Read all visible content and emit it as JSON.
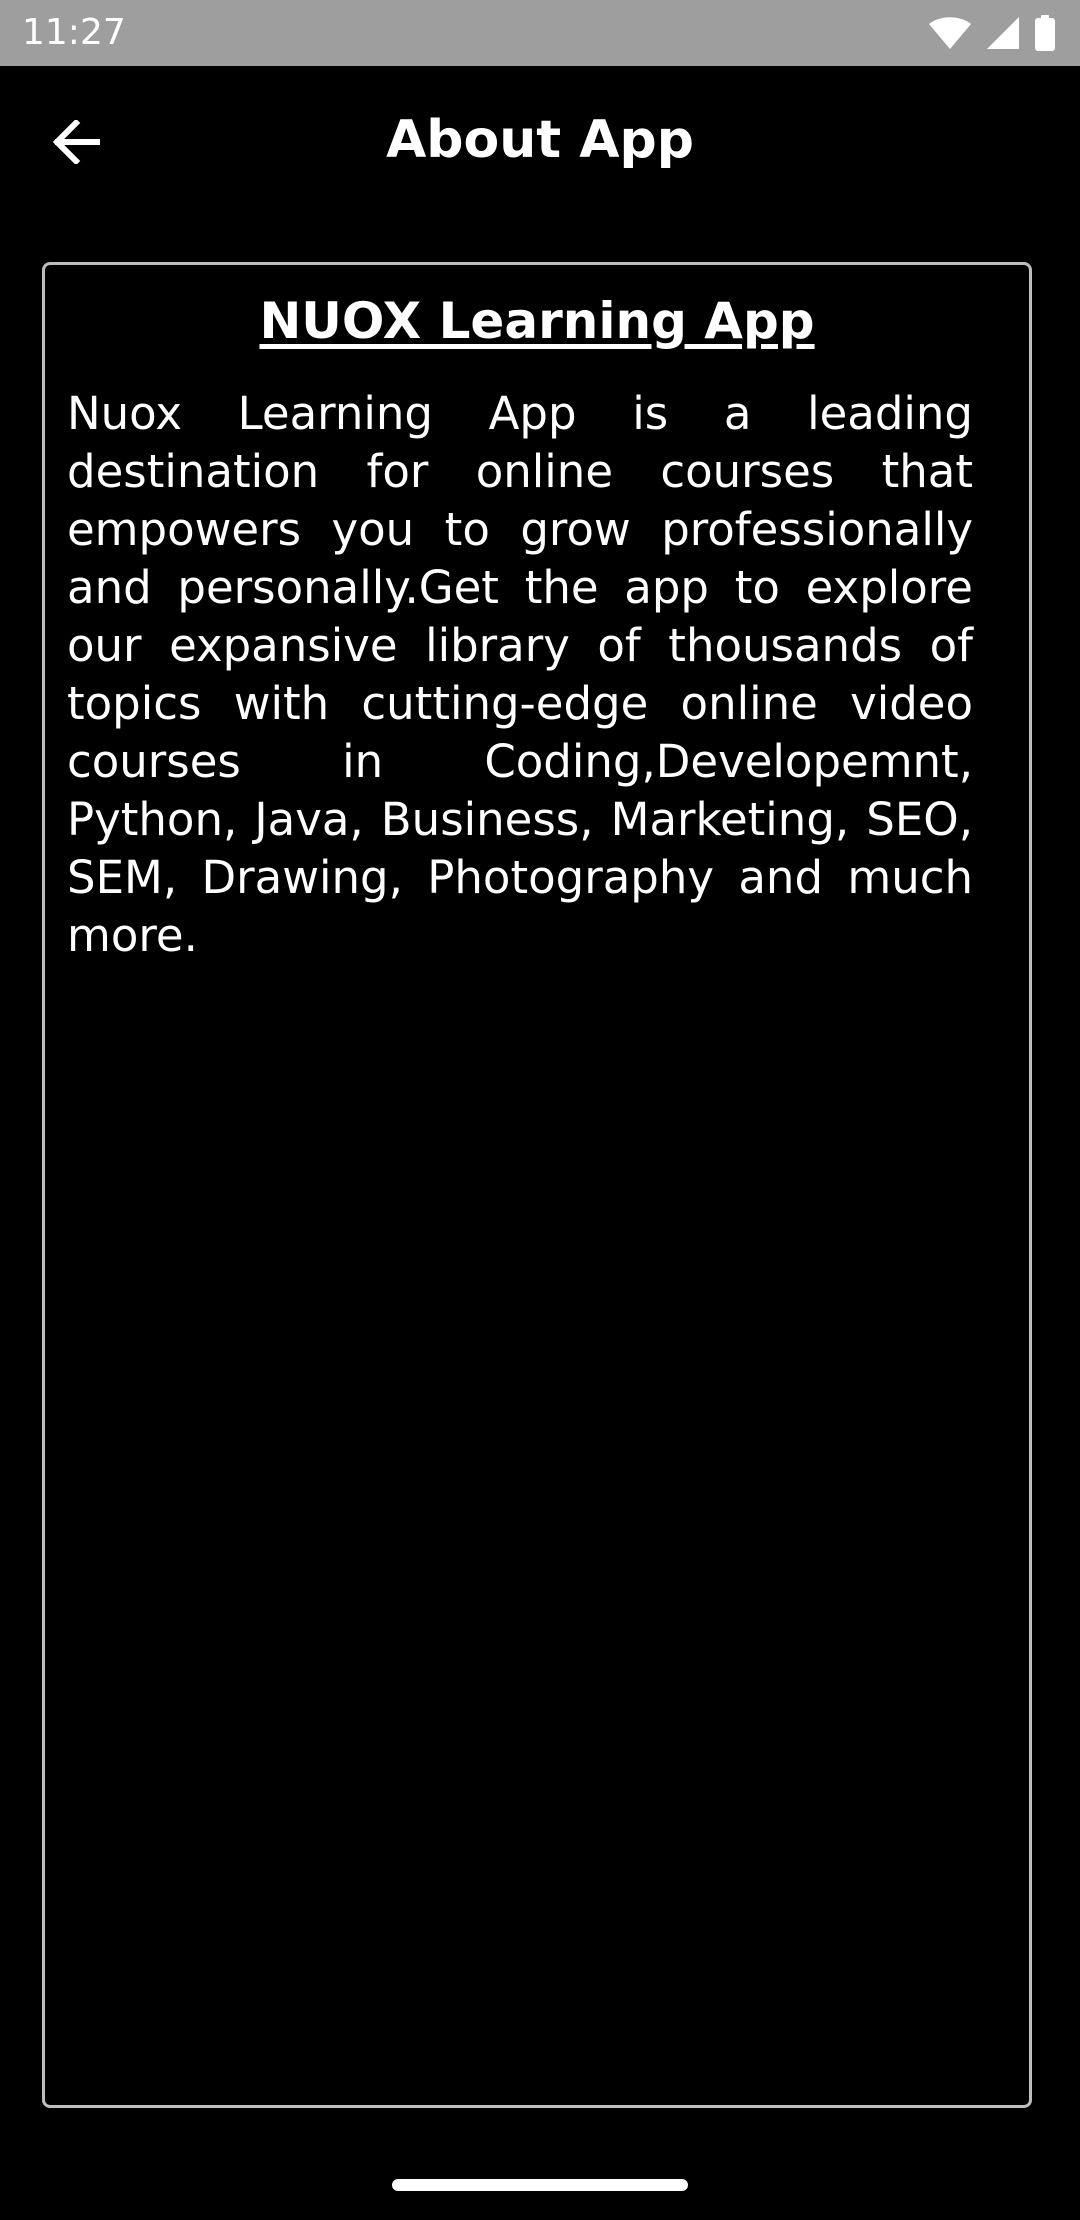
{
  "status_bar": {
    "time": "11:27",
    "icons": [
      "wifi-icon",
      "cellular-signal-icon",
      "battery-icon"
    ]
  },
  "app_bar": {
    "back_icon": "arrow-back-icon",
    "title": "About App"
  },
  "card": {
    "heading": "NUOX Learning App",
    "body": "Nuox Learning App is a leading destination for online courses that empowers you to grow professionally and personally.Get the app to explore our expansive library of thousands of topics with cutting-edge online video courses in Coding,Developemnt, Python, Java, Business, Marketing, SEO, SEM, Drawing, Photography and much more."
  },
  "colors": {
    "background": "#000000",
    "status_bar": "#9e9e9e",
    "text": "#ffffff",
    "card_border": "#bdbdbd"
  }
}
